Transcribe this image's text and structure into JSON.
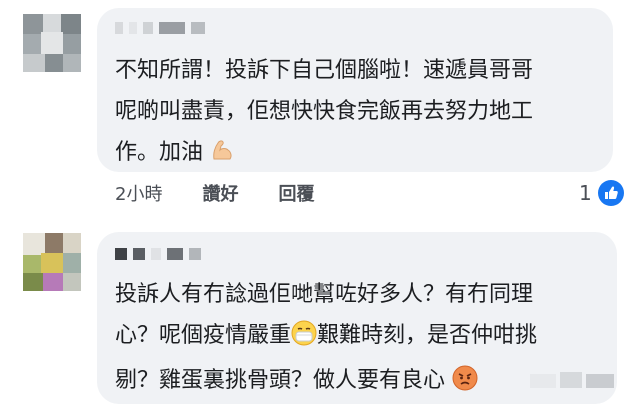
{
  "comments": [
    {
      "body_lines": [
        "不知所謂！投訴下自己個腦啦！速遞員哥哥",
        "呢啲叫盡責，佢想快快食完飯再去努力地工",
        "作。加油"
      ],
      "body_emoji": "flexed-biceps-icon",
      "timestamp": "2小時",
      "like_label": "讚好",
      "reply_label": "回覆",
      "reaction_count": "1",
      "reaction_icon": "thumbs-up-icon"
    },
    {
      "body_lines": [
        "投訴人有冇諗過佢哋幫咗好多人？有冇同理",
        "心？呢個疫情嚴重",
        "艱難時刻，是否仲咁挑",
        "剔？雞蛋裏挑骨頭？做人要有良心"
      ],
      "emoji_mask": "face-with-medical-mask-icon",
      "emoji_angry": "angry-face-icon"
    }
  ],
  "colors": {
    "bubble": "#f0f2f5",
    "text": "#1c1e21",
    "meta": "#4b4f56",
    "like_badge": "#1877f2"
  }
}
